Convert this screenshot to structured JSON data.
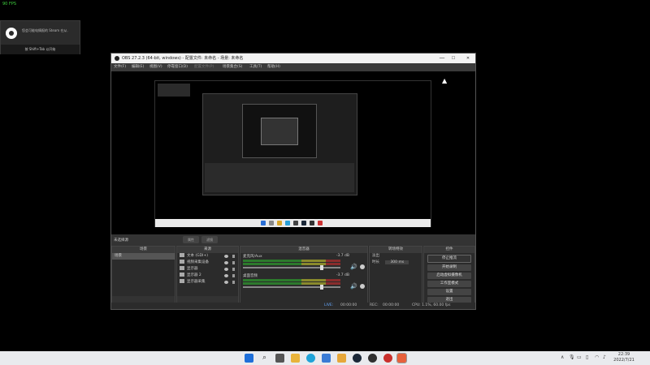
{
  "overlay": {
    "fps": "90 FPS"
  },
  "steam_toast": {
    "message": "您会可能电情报的 Steam 在从.",
    "hint": "按 Shift+Tab 以开始"
  },
  "obs": {
    "title": "OBS 27.2.3 (64-bit, windows) - 配置文件: 未命名 - 场景: 未命名",
    "window_controls": [
      "—",
      "☐",
      "✕"
    ],
    "menu": [
      "文件(F)",
      "编辑(E)",
      "视图(V)",
      "停靠窗口(D)",
      "配置文件(P)",
      "场景集合(S)",
      "工具(T)",
      "帮助(H)"
    ],
    "scene_bar": {
      "label": "未选择源",
      "buttons": [
        "属性",
        "滤镜"
      ]
    },
    "docks": {
      "scenes": {
        "title": "场景",
        "items": [
          "场景"
        ]
      },
      "sources": {
        "title": "来源",
        "items": [
          "文本 (GDI+)",
          "视频采集设备",
          "显示器",
          "显示器 2",
          "显示器采集"
        ]
      },
      "mixer": {
        "title": "混音器",
        "tracks": [
          {
            "name": "麦克风/Aux",
            "db": "-3.7 dB"
          },
          {
            "name": "桌面音频",
            "db": "-3.7 dB"
          }
        ]
      },
      "transitions": {
        "title": "转场特效",
        "type": "淡出",
        "duration_label": "时长",
        "duration": "300 ms"
      },
      "controls": {
        "title": "控件",
        "buttons": [
          "停止推流",
          "开始录制",
          "启动虚拟摄像机",
          "工作室模式",
          "设置",
          "退出"
        ]
      }
    },
    "status": {
      "live_label": "LIVE:",
      "live_time": "00:00:00",
      "rec_label": "REC:",
      "rec_time": "00:00:00",
      "cpu": "CPU: 1.1%, 60.00 fps"
    },
    "footer_glyphs": {
      "add": "+",
      "remove": "−",
      "up": "∧",
      "down": "∨",
      "settings": "⚙"
    }
  },
  "taskbar": {
    "icons": [
      "windows-start",
      "search",
      "task-view",
      "file-explorer",
      "edge",
      "store",
      "game-app",
      "steam",
      "obs",
      "red-app",
      "active-app"
    ],
    "tray": {
      "chevron": "∧"
    },
    "clock": {
      "time": "22:39",
      "date": "2022/7/21"
    }
  },
  "colors": {
    "obs_bg": "#2b2b2b",
    "taskbar": "#e9ebee",
    "fps": "#3fd13f"
  }
}
